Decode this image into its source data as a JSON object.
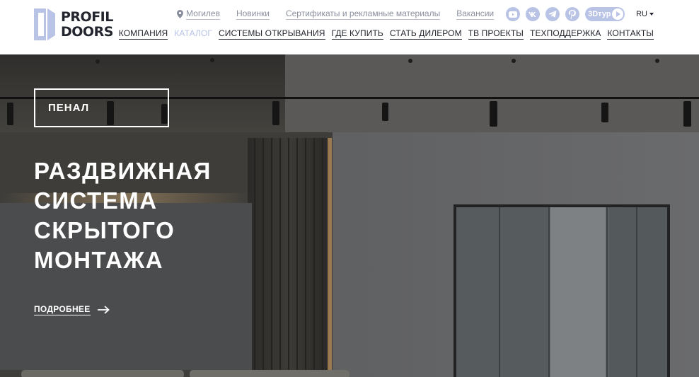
{
  "header": {
    "logo": {
      "line1": "PROFIL",
      "line2": "DOORS"
    },
    "top_links": {
      "city": "Могилев",
      "news": "Новинки",
      "certificates": "Сертификаты и рекламные материалы",
      "vacancies": "Вакансии"
    },
    "socials": [
      "youtube-icon",
      "vk-icon",
      "telegram-icon",
      "pinterest-icon"
    ],
    "tour_label": "3Dтур",
    "lang": "RU",
    "nav": [
      {
        "label": "КОМПАНИЯ",
        "active": false
      },
      {
        "label": "КАТАЛОГ",
        "active": true
      },
      {
        "label": "СИСТЕМЫ ОТКРЫВАНИЯ",
        "active": false
      },
      {
        "label": "ГДЕ КУПИТЬ",
        "active": false
      },
      {
        "label": "СТАТЬ ДИЛЕРОМ",
        "active": false
      },
      {
        "label": "ТВ ПРОЕКТЫ",
        "active": false
      },
      {
        "label": "ТЕХПОДДЕРЖКА",
        "active": false
      },
      {
        "label": "КОНТАКТЫ",
        "active": false
      }
    ]
  },
  "hero": {
    "badge": "ПЕНАЛ",
    "title_lines": [
      "РАЗДВИЖНАЯ",
      "СИСТЕМА",
      "СКРЫТОГО",
      "МОНТАЖА"
    ],
    "more_label": "ПОДРОБНЕЕ"
  },
  "colors": {
    "accent": "#b9c3e6",
    "text_dark": "#22252d",
    "muted": "#8a8f9e"
  }
}
